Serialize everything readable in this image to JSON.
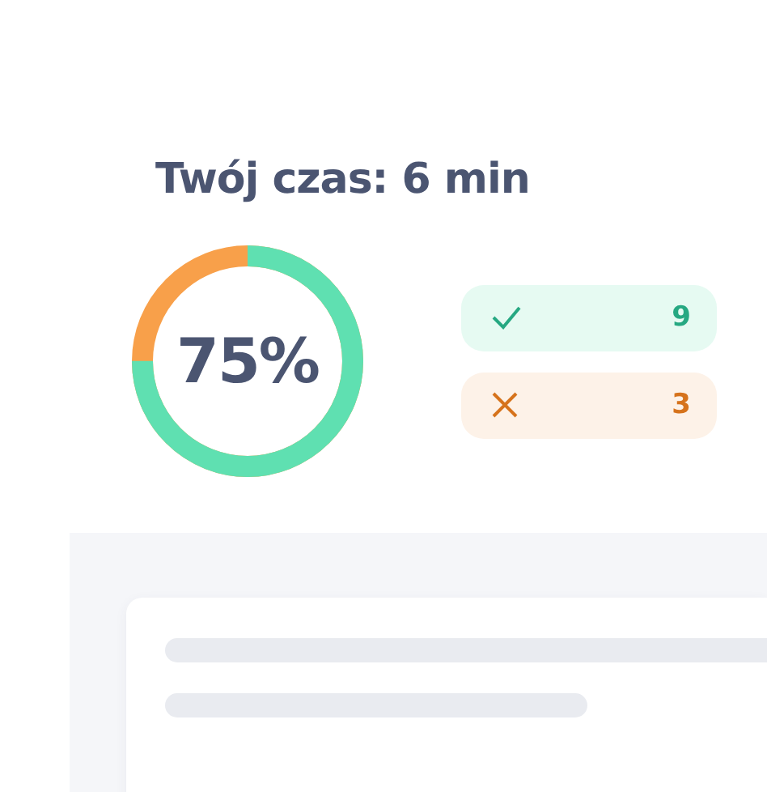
{
  "title": "Twój czas: 6 min",
  "score": {
    "text": "75%",
    "level": 0.75
  },
  "results": [
    {
      "kind": "correct",
      "count": "9"
    },
    {
      "kind": "wrong",
      "count": "3"
    }
  ]
}
